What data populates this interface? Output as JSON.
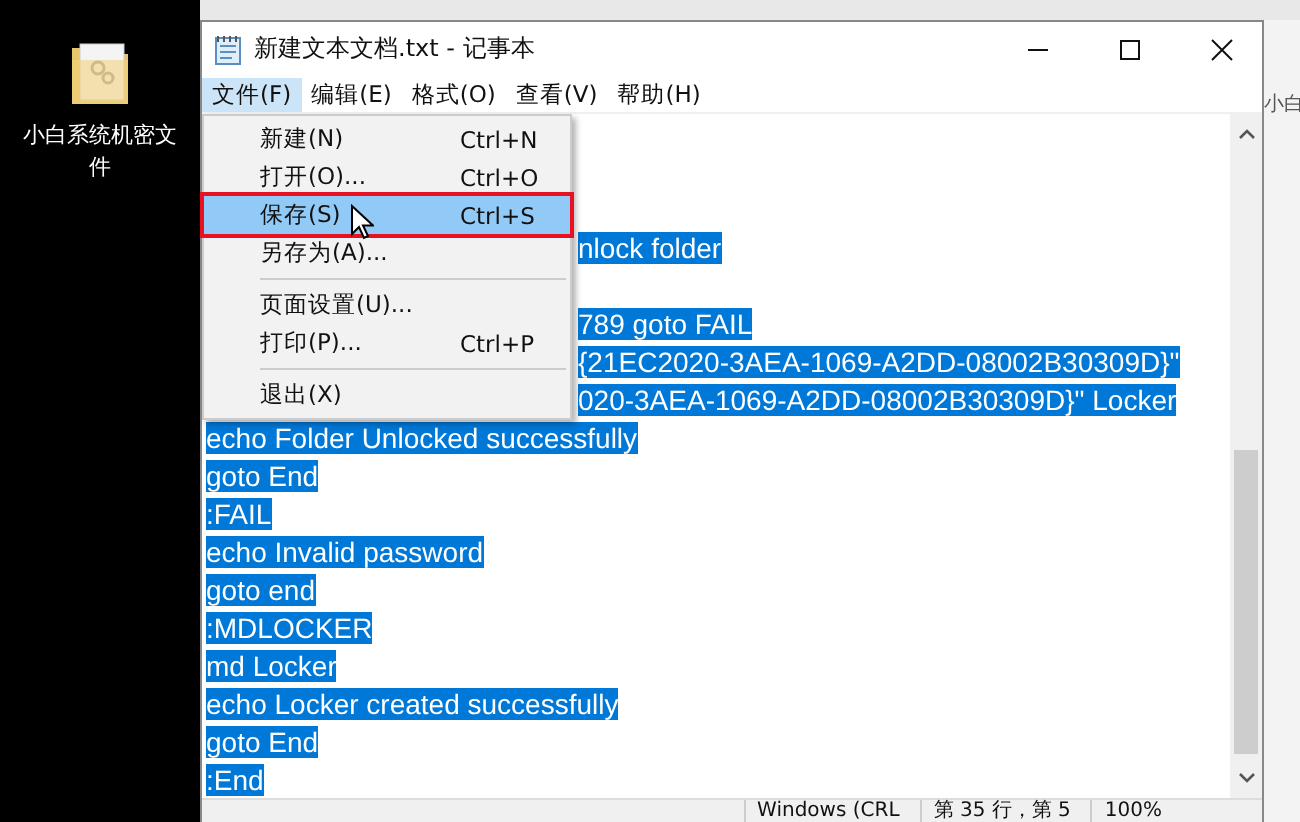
{
  "desktop": {
    "icon_label": "小白系统机密文件"
  },
  "background_window": {
    "text": "小白"
  },
  "window": {
    "title": "新建文本文档.txt - 记事本"
  },
  "menubar": [
    {
      "label": "文件(F)",
      "selected": true
    },
    {
      "label": "编辑(E)",
      "selected": false
    },
    {
      "label": "格式(O)",
      "selected": false
    },
    {
      "label": "查看(V)",
      "selected": false
    },
    {
      "label": "帮助(H)",
      "selected": false
    }
  ],
  "menu": [
    {
      "kind": "item",
      "label": "新建(N)",
      "shortcut": "Ctrl+N",
      "selected": false
    },
    {
      "kind": "item",
      "label": "打开(O)...",
      "shortcut": "Ctrl+O",
      "selected": false
    },
    {
      "kind": "item",
      "label": "保存(S)",
      "shortcut": "Ctrl+S",
      "selected": true
    },
    {
      "kind": "item",
      "label": "另存为(A)...",
      "selected": false
    },
    {
      "kind": "separator"
    },
    {
      "kind": "item",
      "label": "页面设置(U)...",
      "selected": false
    },
    {
      "kind": "item",
      "label": "打印(P)...",
      "shortcut": "Ctrl+P",
      "selected": false
    },
    {
      "kind": "separator"
    },
    {
      "kind": "item",
      "label": "退出(X)",
      "selected": false
    }
  ],
  "editor": {
    "lines": [
      {
        "covered": true
      },
      {
        "covered": true
      },
      {
        "text": "nlock folder",
        "partial": true
      },
      {
        "covered": true
      },
      {
        "text": "789 goto FAIL",
        "partial": true
      },
      {
        "text": "{21EC2020-3AEA-1069-A2DD-08002B30309D}\"",
        "partial": true
      },
      {
        "text": "020-3AEA-1069-A2DD-08002B30309D}\" Locker",
        "partial": true
      },
      {
        "text": "echo Folder Unlocked successfully"
      },
      {
        "text": "goto End"
      },
      {
        "text": ":FAIL"
      },
      {
        "text": "echo Invalid password"
      },
      {
        "text": "goto end"
      },
      {
        "text": ":MDLOCKER"
      },
      {
        "text": "md Locker"
      },
      {
        "text": "echo Locker created successfully"
      },
      {
        "text": "goto End"
      },
      {
        "text": ":End"
      }
    ]
  },
  "status_bar": [
    "Windows (CRL",
    "第 35 行，第 5",
    "100%"
  ]
}
